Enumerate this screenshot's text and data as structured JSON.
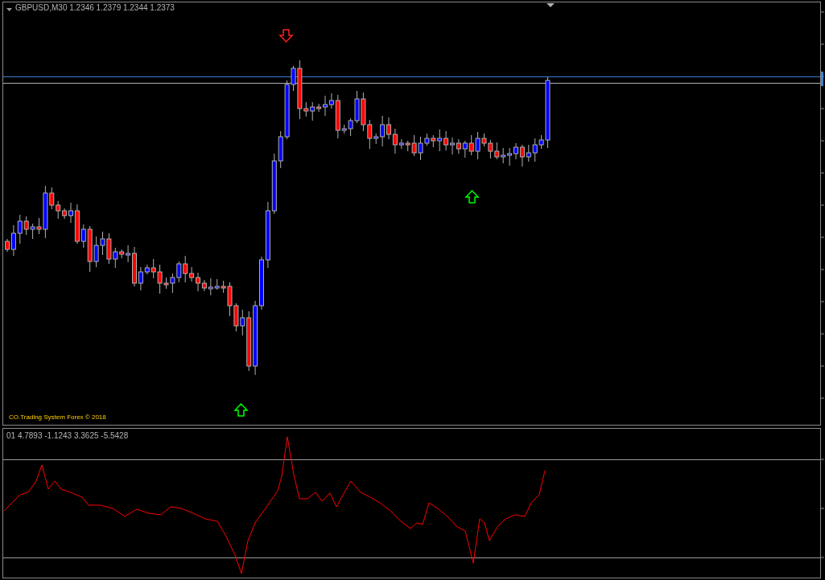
{
  "main_chart": {
    "symbol_header": "GBPUSD,M30  1.2346 1.2379 1.2344 1.2373",
    "copyright": "CO.Trading System Forex  © 2018"
  },
  "indicator_panel": {
    "header": "01 4.7893 -1.1243 3.3625 -5.5428"
  }
}
